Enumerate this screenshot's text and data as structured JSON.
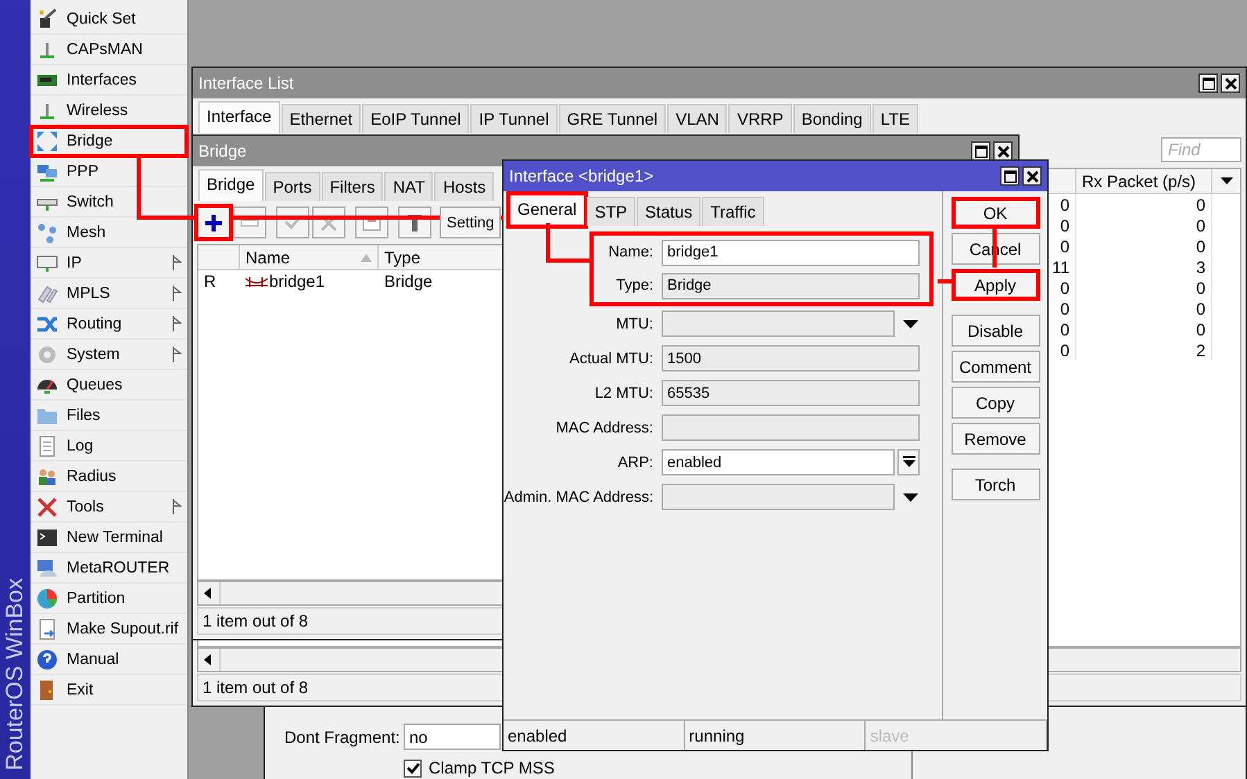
{
  "sidebar": {
    "brand": "RouterOS WinBox",
    "items": [
      {
        "label": "Quick Set",
        "has_submenu": false,
        "highlighted": false
      },
      {
        "label": "CAPsMAN",
        "has_submenu": false,
        "highlighted": false
      },
      {
        "label": "Interfaces",
        "has_submenu": false,
        "highlighted": false
      },
      {
        "label": "Wireless",
        "has_submenu": false,
        "highlighted": false
      },
      {
        "label": "Bridge",
        "has_submenu": false,
        "highlighted": true
      },
      {
        "label": "PPP",
        "has_submenu": false,
        "highlighted": false
      },
      {
        "label": "Switch",
        "has_submenu": false,
        "highlighted": false
      },
      {
        "label": "Mesh",
        "has_submenu": false,
        "highlighted": false
      },
      {
        "label": "IP",
        "has_submenu": true,
        "highlighted": false
      },
      {
        "label": "MPLS",
        "has_submenu": true,
        "highlighted": false
      },
      {
        "label": "Routing",
        "has_submenu": true,
        "highlighted": false
      },
      {
        "label": "System",
        "has_submenu": true,
        "highlighted": false
      },
      {
        "label": "Queues",
        "has_submenu": false,
        "highlighted": false
      },
      {
        "label": "Files",
        "has_submenu": false,
        "highlighted": false
      },
      {
        "label": "Log",
        "has_submenu": false,
        "highlighted": false
      },
      {
        "label": "Radius",
        "has_submenu": false,
        "highlighted": false
      },
      {
        "label": "Tools",
        "has_submenu": true,
        "highlighted": false
      },
      {
        "label": "New Terminal",
        "has_submenu": false,
        "highlighted": false
      },
      {
        "label": "MetaROUTER",
        "has_submenu": false,
        "highlighted": false
      },
      {
        "label": "Partition",
        "has_submenu": false,
        "highlighted": false
      },
      {
        "label": "Make Supout.rif",
        "has_submenu": false,
        "highlighted": false
      },
      {
        "label": "Manual",
        "has_submenu": false,
        "highlighted": false
      },
      {
        "label": "Exit",
        "has_submenu": false,
        "highlighted": false
      }
    ]
  },
  "back_window": {
    "field": {
      "label": "Dont Fragment:",
      "value": "no"
    },
    "checkbox": {
      "label": "Clamp TCP MSS",
      "checked": true
    }
  },
  "interface_list": {
    "title": "Interface List",
    "tabs": [
      {
        "label": "Interface",
        "selected": true
      },
      {
        "label": "Ethernet",
        "selected": false
      },
      {
        "label": "EoIP Tunnel",
        "selected": false
      },
      {
        "label": "IP Tunnel",
        "selected": false
      },
      {
        "label": "GRE Tunnel",
        "selected": false
      },
      {
        "label": "VLAN",
        "selected": false
      },
      {
        "label": "VRRP",
        "selected": false
      },
      {
        "label": "Bonding",
        "selected": false
      },
      {
        "label": "LTE",
        "selected": false
      }
    ],
    "search": {
      "placeholder": "Find"
    },
    "table": {
      "columns": [
        "Rx Packet (p/s)"
      ],
      "rows": [
        {
          "column_1": "0",
          "rx_packet": "0"
        },
        {
          "column_1": "0",
          "rx_packet": "0"
        },
        {
          "column_1": "0",
          "rx_packet": "0"
        },
        {
          "column_1": "11",
          "rx_packet": "3"
        },
        {
          "column_1": "0",
          "rx_packet": "0"
        },
        {
          "column_1": "0",
          "rx_packet": "0"
        },
        {
          "column_1": "0",
          "rx_packet": "0"
        },
        {
          "column_1": "0",
          "rx_packet": "2"
        }
      ]
    },
    "status": "1 item out of 8"
  },
  "bridge": {
    "title": "Bridge",
    "tabs": [
      {
        "label": "Bridge",
        "selected": true
      },
      {
        "label": "Ports",
        "selected": false
      },
      {
        "label": "Filters",
        "selected": false
      },
      {
        "label": "NAT",
        "selected": false
      },
      {
        "label": "Hosts",
        "selected": false
      }
    ],
    "toolbar": [
      {
        "kind": "add",
        "highlighted": true
      },
      {
        "kind": "remove",
        "highlighted": false
      },
      {
        "kind": "enable",
        "highlighted": false
      },
      {
        "kind": "disable",
        "highlighted": false
      },
      {
        "kind": "comment",
        "highlighted": false
      },
      {
        "kind": "filter",
        "highlighted": false
      },
      {
        "kind": "text",
        "label": "Setting"
      }
    ],
    "table": {
      "columns": [
        "Name",
        "Type"
      ],
      "rows": [
        {
          "flag": "R",
          "name": "bridge1",
          "type": "Bridge"
        }
      ]
    },
    "status": "1 item out of 8"
  },
  "dialog": {
    "title": "Interface <bridge1>",
    "tabs": [
      {
        "label": "General",
        "selected": true,
        "highlighted": true
      },
      {
        "label": "STP",
        "selected": false,
        "highlighted": false
      },
      {
        "label": "Status",
        "selected": false,
        "highlighted": false
      },
      {
        "label": "Traffic",
        "selected": false,
        "highlighted": false
      }
    ],
    "fields": [
      {
        "label": "Name:",
        "kind": "text",
        "value": "bridge1",
        "highlighted": true
      },
      {
        "label": "Type:",
        "kind": "readonly",
        "value": "Bridge",
        "highlighted": true
      },
      {
        "label": "MTU:",
        "kind": "combo",
        "highlighted": false
      },
      {
        "label": "Actual MTU:",
        "kind": "readonly",
        "value": "1500",
        "highlighted": false
      },
      {
        "label": "L2 MTU:",
        "kind": "readonly",
        "value": "65535",
        "highlighted": false
      },
      {
        "label": "MAC Address:",
        "kind": "readonly",
        "highlighted": false
      },
      {
        "label": "ARP:",
        "kind": "select",
        "value": "enabled",
        "highlighted": false
      },
      {
        "label": "Admin. MAC Address:",
        "kind": "combo",
        "highlighted": false
      }
    ],
    "buttons": [
      {
        "label": "OK",
        "highlighted": true
      },
      {
        "label": "Cancel",
        "highlighted": false
      },
      {
        "label": "Apply",
        "highlighted": true
      },
      {
        "label": "Disable",
        "highlighted": false
      },
      {
        "label": "Comment",
        "highlighted": false
      },
      {
        "label": "Copy",
        "highlighted": false
      },
      {
        "label": "Remove",
        "highlighted": false
      },
      {
        "label": "Torch",
        "highlighted": false
      }
    ],
    "status": [
      {
        "text": "enabled",
        "disabled": false
      },
      {
        "text": "running",
        "disabled": false
      },
      {
        "text": "slave",
        "disabled": true
      }
    ]
  }
}
